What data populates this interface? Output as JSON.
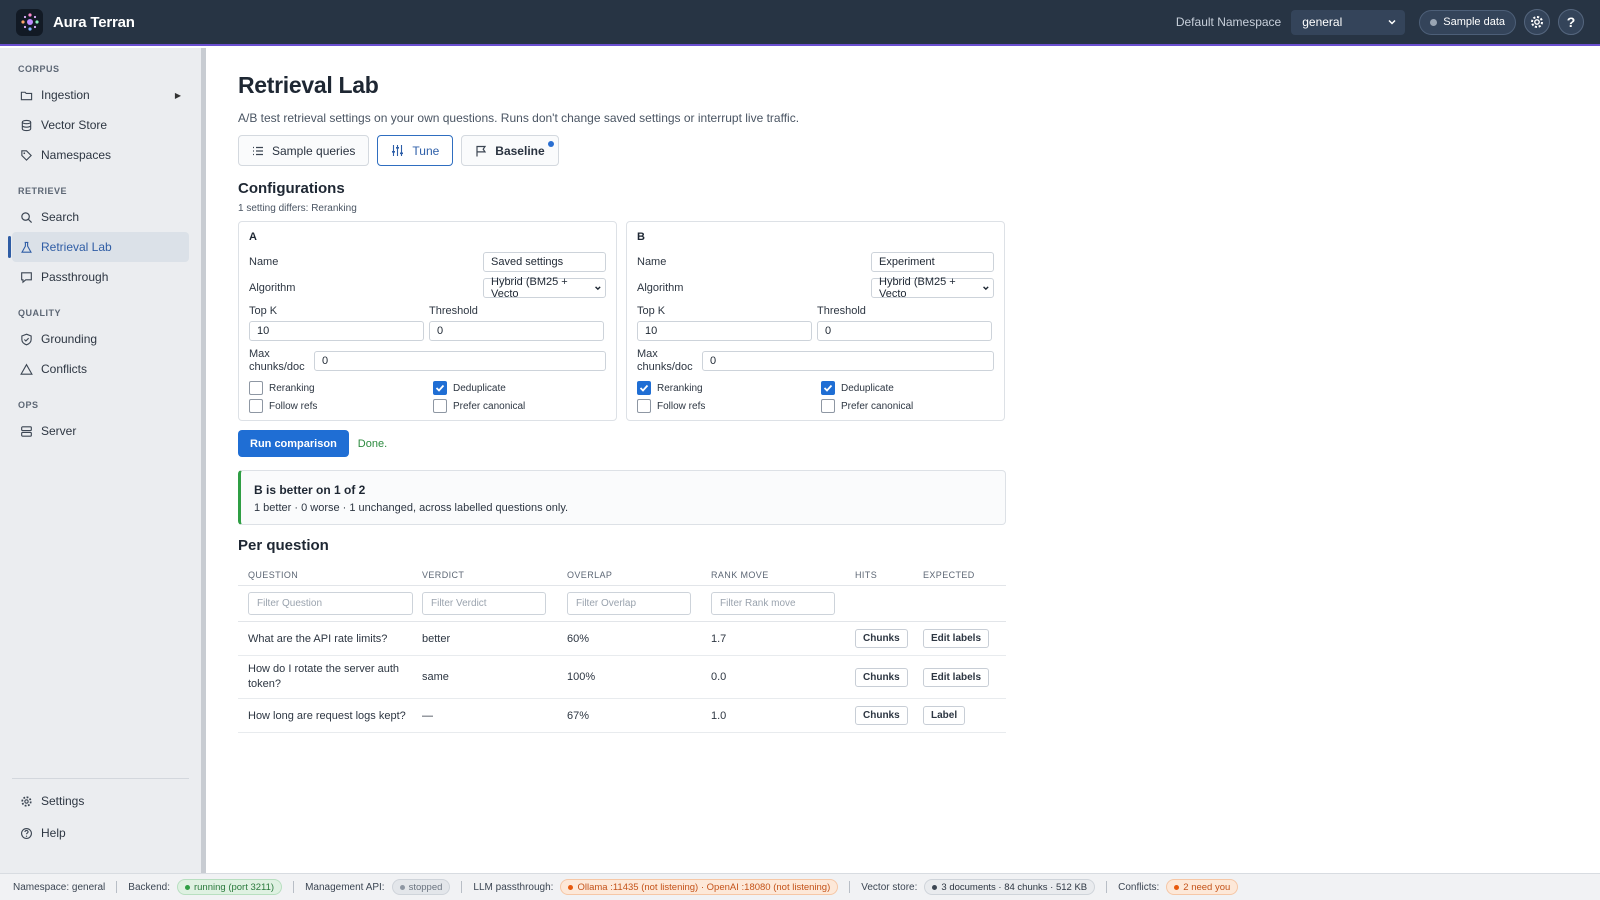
{
  "app": {
    "name": "Aura Terran"
  },
  "header": {
    "namespace_label": "Default Namespace",
    "namespace_value": "general",
    "sample_data_label": "Sample data",
    "help_label": "?"
  },
  "sidebar": {
    "corpus_heading": "CORPUS",
    "ingestion": "Ingestion",
    "vector_store": "Vector Store",
    "namespaces": "Namespaces",
    "retrieve_heading": "RETRIEVE",
    "search": "Search",
    "retrieval_lab": "Retrieval Lab",
    "passthrough": "Passthrough",
    "quality_heading": "QUALITY",
    "grounding": "Grounding",
    "conflicts": "Conflicts",
    "ops_heading": "OPS",
    "server": "Server",
    "settings": "Settings",
    "help": "Help"
  },
  "main": {
    "title": "Retrieval Lab",
    "description": "A/B test retrieval settings on your own questions. Runs don't change saved settings or interrupt live traffic.",
    "tabs": {
      "sample_queries": "Sample queries",
      "tune": "Tune",
      "baseline": "Baseline"
    },
    "configurations_title": "Configurations",
    "differs_note": "1 setting differs: Reranking",
    "labels": {
      "name": "Name",
      "algorithm": "Algorithm",
      "top_k": "Top K",
      "threshold": "Threshold",
      "max_chunks_1": "Max",
      "max_chunks_2": "chunks/doc",
      "reranking": "Reranking",
      "deduplicate": "Deduplicate",
      "follow_refs": "Follow refs",
      "prefer_canonical": "Prefer canonical"
    },
    "config_a": {
      "letter": "A",
      "name": "Saved settings",
      "algorithm": "Hybrid (BM25 + Vecto",
      "top_k": "10",
      "threshold": "0",
      "max_chunks": "0"
    },
    "config_b": {
      "letter": "B",
      "name": "Experiment",
      "algorithm": "Hybrid (BM25 + Vecto",
      "top_k": "10",
      "threshold": "0",
      "max_chunks": "0"
    },
    "run_button": "Run comparison",
    "run_status": "Done.",
    "result": {
      "title": "B is better on 1 of 2",
      "subtitle": "1 better · 0 worse · 1 unchanged, across labelled questions only."
    },
    "per_question_title": "Per question",
    "table": {
      "headers": {
        "question": "QUESTION",
        "verdict": "VERDICT",
        "overlap": "OVERLAP",
        "rank_move": "RANK MOVE",
        "hits": "HITS",
        "expected": "EXPECTED"
      },
      "filters": {
        "question": "Filter Question",
        "verdict": "Filter Verdict",
        "overlap": "Filter Overlap",
        "rank_move": "Filter Rank move"
      },
      "rows": [
        {
          "question": "What are the API rate limits?",
          "verdict": "better",
          "overlap": "60%",
          "rank_move": "1.7",
          "hits": "Chunks",
          "expected": "Edit labels"
        },
        {
          "question": "How do I rotate the server auth token?",
          "verdict": "same",
          "overlap": "100%",
          "rank_move": "0.0",
          "hits": "Chunks",
          "expected": "Edit labels"
        },
        {
          "question": "How long are request logs kept?",
          "verdict": "—",
          "overlap": "67%",
          "rank_move": "1.0",
          "hits": "Chunks",
          "expected": "Label"
        }
      ]
    }
  },
  "statusbar": {
    "namespace": "Namespace: general",
    "backend_label": "Backend:",
    "backend_value": "running (port 3211)",
    "mgmt_label": "Management API:",
    "mgmt_value": "stopped",
    "llm_label": "LLM passthrough:",
    "llm_value": "Ollama :11435 (not listening) · OpenAI :18080 (not listening)",
    "vector_label": "Vector store:",
    "vector_value": "3 documents · 84 chunks · 512 KB",
    "conflicts_label": "Conflicts:",
    "conflicts_value": "2 need you"
  },
  "colors": {
    "accent": "#1f6ed4",
    "header_bg": "#273444",
    "success": "#2f9e44",
    "warning": "#e8590c"
  }
}
